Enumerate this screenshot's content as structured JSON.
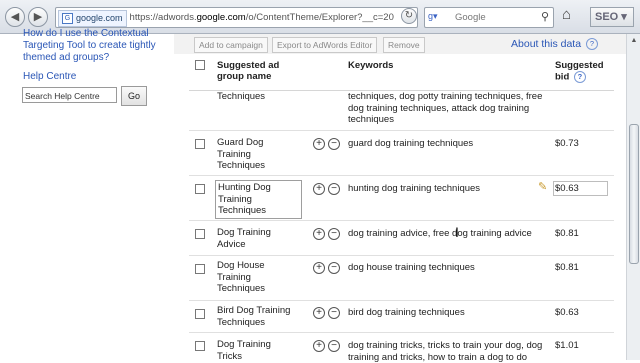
{
  "browser": {
    "site_identity": "google.com",
    "url_prefix": "https://adwords.",
    "url_domain": "google.com",
    "url_path": "/o/ContentTheme/Explorer?__c=20",
    "search_engine": "Google",
    "search_placeholder": "Google",
    "seo_button": "SEO"
  },
  "sidebar": {
    "link_text": "How do I use the Contextual Targeting Tool to create tightly themed ad groups?",
    "help_title": "Help Centre",
    "help_search_placeholder": "Search Help Centre",
    "go_label": "Go"
  },
  "actions": {
    "add_to_campaign": "Add to campaign",
    "export": "Export to AdWords Editor",
    "remove": "Remove",
    "about_link": "About this data",
    "help_icon": "?"
  },
  "table": {
    "headers": {
      "ad_group_name": "Suggested ad group name",
      "keywords": "Keywords",
      "bid": "Suggested bid",
      "bid_help": "?"
    },
    "rows": [
      {
        "name": "Techniques",
        "keywords": "techniques, dog potty training techniques, free dog training techniques, attack dog training techniques",
        "bid": ""
      },
      {
        "name": "Guard Dog Training Techniques",
        "keywords": "guard dog training techniques",
        "bid": "$0.73"
      },
      {
        "name": "Hunting Dog Training Techniques",
        "keywords": "hunting dog training techniques",
        "bid": "$0.63"
      },
      {
        "name": "Dog Training Advice",
        "keywords": "dog training advice, free dog training advice",
        "bid": "$0.81"
      },
      {
        "name": "Dog House Training Techniques",
        "keywords": "dog house training techniques",
        "bid": "$0.81"
      },
      {
        "name": "Bird Dog Training Techniques",
        "keywords": "bird dog training techniques",
        "bid": "$0.63"
      },
      {
        "name": "Dog Training Tricks",
        "keywords": "dog training tricks, tricks to train your dog, dog training and tricks, how to train a dog to do",
        "bid": "$1.01"
      }
    ]
  },
  "icons": {
    "back": "back-arrow-icon",
    "forward": "forward-arrow-icon",
    "reload": "reload-icon",
    "search": "magnifier-icon",
    "home": "home-icon",
    "edit": "pencil-icon"
  }
}
